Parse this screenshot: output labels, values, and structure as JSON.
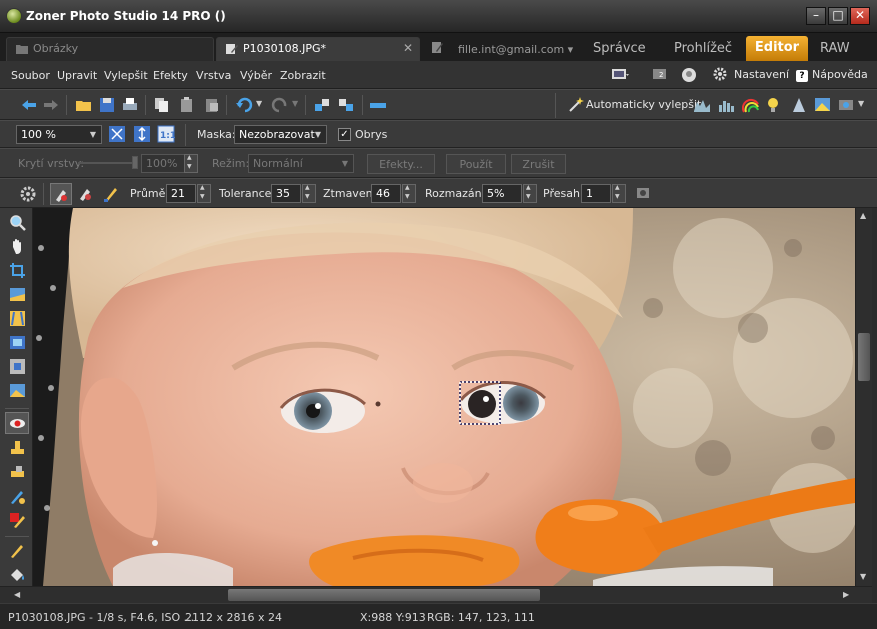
{
  "window": {
    "title": "Zoner Photo Studio 14 PRO  ()",
    "minimize": "–",
    "maximize": "□",
    "close": "✕"
  },
  "tabs": {
    "browser_tab": "Obrázky",
    "file_tab": "P1030108.JPG*",
    "file_tab_close": "✕",
    "account": "fille.int@gmail.com ▾"
  },
  "modes": [
    "Správce",
    "Prohlížeč",
    "Editor",
    "RAW"
  ],
  "menu": [
    "Soubor",
    "Upravit",
    "Vylepšit",
    "Efekty",
    "Vrstva",
    "Výběr",
    "Zobrazit"
  ],
  "menu_right": {
    "settings": "Nastavení",
    "help": "Nápověda"
  },
  "toolbar": {
    "auto_enhance": "Automaticky vylepšit"
  },
  "view": {
    "zoom": "100 %",
    "mask_label": "Maska:",
    "mask_value": "Nezobrazovat",
    "outline_label": "Obrys",
    "outline_checked": true
  },
  "layer": {
    "opacity_label": "Krytí vrstvy:",
    "opacity_value": "100%",
    "mode_label": "Režim:",
    "mode_value": "Normální",
    "effects": "Efekty...",
    "apply": "Použít",
    "cancel": "Zrušit"
  },
  "tool": {
    "diameter_label": "Průměr:",
    "diameter_value": "21",
    "tolerance_label": "Tolerance:",
    "tolerance_value": "35",
    "darken_label": "Ztmavení:",
    "darken_value": "46",
    "blur_label": "Rozmazání:",
    "blur_value": "5%",
    "overlap_label": "Přesah:",
    "overlap_value": "1"
  },
  "status": {
    "file_info": "P1030108.JPG - 1/8 s, F4.6, ISO ...",
    "dimensions": "2112 x 2816 x 24",
    "coords": "X:988 Y:913",
    "rgb": "RGB: 147, 123, 111"
  },
  "colors": {
    "accent": "#e69a1a",
    "background": "#3a3a3a"
  }
}
